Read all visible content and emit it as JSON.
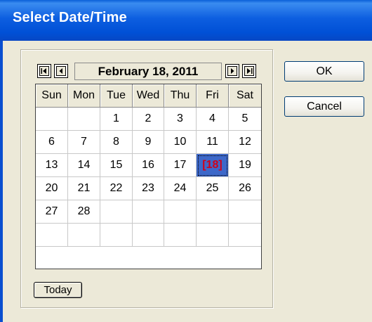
{
  "window": {
    "title": "Select Date/Time"
  },
  "calendar": {
    "current_date_label": "February 18, 2011",
    "nav": {
      "first_icon": "skip-back-icon",
      "prev_icon": "prev-icon",
      "next_icon": "next-icon",
      "last_icon": "skip-forward-icon"
    },
    "weekdays": [
      "Sun",
      "Mon",
      "Tue",
      "Wed",
      "Thu",
      "Fri",
      "Sat"
    ],
    "weeks": [
      [
        "",
        "",
        "1",
        "2",
        "3",
        "4",
        "5"
      ],
      [
        "6",
        "7",
        "8",
        "9",
        "10",
        "11",
        "12"
      ],
      [
        "13",
        "14",
        "15",
        "16",
        "17",
        "[18]",
        "19"
      ],
      [
        "20",
        "21",
        "22",
        "23",
        "24",
        "25",
        "26"
      ],
      [
        "27",
        "28",
        "",
        "",
        "",
        "",
        ""
      ],
      [
        "",
        "",
        "",
        "",
        "",
        "",
        ""
      ]
    ],
    "selected_day": "18",
    "today_label": "Today"
  },
  "buttons": {
    "ok_label": "OK",
    "cancel_label": "Cancel"
  },
  "colors": {
    "title_bar": "#0054e3",
    "selected_bg": "#3d68c9",
    "selected_text": "#d0021b",
    "dialog_bg": "#ece9d8"
  }
}
